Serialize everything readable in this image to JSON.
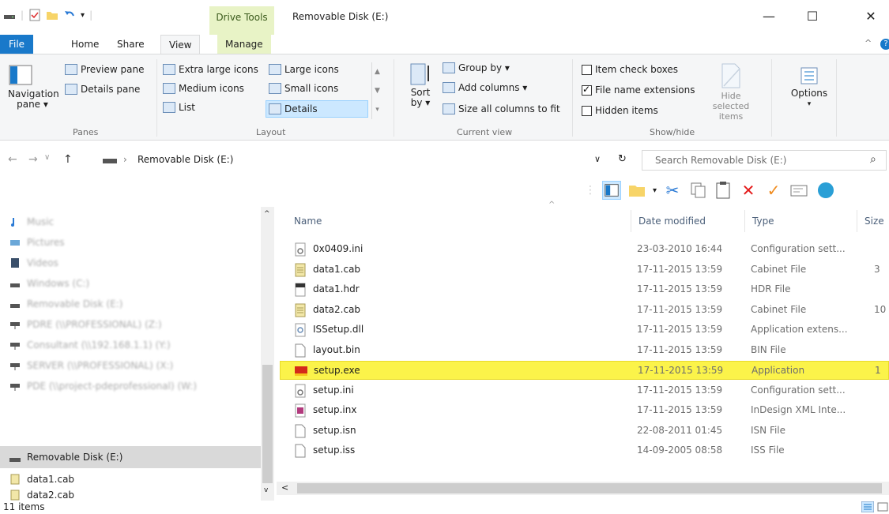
{
  "window": {
    "title": "Removable Disk (E:)",
    "context_tab": "Drive Tools",
    "minimize": "—",
    "maximize": "☐",
    "close": "✕"
  },
  "tabs": {
    "file": "File",
    "home": "Home",
    "share": "Share",
    "view": "View",
    "manage": "Manage"
  },
  "ribbon": {
    "panes": {
      "navigation_pane": "Navigation pane ▾",
      "preview_pane": "Preview pane",
      "details_pane": "Details pane",
      "label": "Panes"
    },
    "layout": {
      "extra_large_icons": "Extra large icons",
      "large_icons": "Large icons",
      "medium_icons": "Medium icons",
      "small_icons": "Small icons",
      "list": "List",
      "details": "Details",
      "label": "Layout"
    },
    "current_view": {
      "sort_by": "Sort by ▾",
      "group_by": "Group by ▾",
      "add_columns": "Add columns ▾",
      "size_all_columns": "Size all columns to fit",
      "label": "Current view"
    },
    "show_hide": {
      "item_check_boxes": "Item check boxes",
      "file_name_extensions": "File name extensions",
      "hidden_items": "Hidden items",
      "hide_selected_items": "Hide selected items",
      "label": "Show/hide",
      "file_name_extensions_checked": true
    },
    "options": "Options"
  },
  "address": {
    "path": "Removable Disk (E:)",
    "search_placeholder": "Search Removable Disk (E:)"
  },
  "nav_pane": {
    "items": [
      {
        "label": "Music",
        "blurred": true
      },
      {
        "label": "Pictures",
        "blurred": true
      },
      {
        "label": "Videos",
        "blurred": true
      },
      {
        "label": "Windows (C:)",
        "blurred": true
      },
      {
        "label": "Removable Disk (E:)",
        "blurred": true
      },
      {
        "label": "PDRE (\\\\PROFESSIONAL) (Z:)",
        "blurred": true
      },
      {
        "label": "Consultant (\\\\192.168.1.1) (Y:)",
        "blurred": true
      },
      {
        "label": "SERVER (\\\\PROFESSIONAL) (X:)",
        "blurred": true
      },
      {
        "label": "PDE (\\\\project-pdeprofessional) (W:)",
        "blurred": true
      },
      {
        "label": "Removable Disk (E:)",
        "blurred": false,
        "selected": true
      },
      {
        "label": "data1.cab",
        "blurred": false
      },
      {
        "label": "data2.cab",
        "blurred": false
      }
    ]
  },
  "columns": {
    "name": "Name",
    "date_modified": "Date modified",
    "type": "Type",
    "size": "Size"
  },
  "files": [
    {
      "name": "0x0409.ini",
      "date": "23-03-2010 16:44",
      "type": "Configuration sett...",
      "size": "",
      "icon": "settings-file-icon"
    },
    {
      "name": "data1.cab",
      "date": "17-11-2015 13:59",
      "type": "Cabinet File",
      "size": "3",
      "icon": "cabinet-file-icon"
    },
    {
      "name": "data1.hdr",
      "date": "17-11-2015 13:59",
      "type": "HDR File",
      "size": "",
      "icon": "hdr-file-icon"
    },
    {
      "name": "data2.cab",
      "date": "17-11-2015 13:59",
      "type": "Cabinet File",
      "size": "10",
      "icon": "cabinet-file-icon"
    },
    {
      "name": "ISSetup.dll",
      "date": "17-11-2015 13:59",
      "type": "Application extens...",
      "size": "",
      "icon": "dll-file-icon"
    },
    {
      "name": "layout.bin",
      "date": "17-11-2015 13:59",
      "type": "BIN File",
      "size": "",
      "icon": "blank-file-icon"
    },
    {
      "name": "setup.exe",
      "date": "17-11-2015 13:59",
      "type": "Application",
      "size": "1",
      "icon": "application-icon",
      "selected": true
    },
    {
      "name": "setup.ini",
      "date": "17-11-2015 13:59",
      "type": "Configuration sett...",
      "size": "",
      "icon": "settings-file-icon"
    },
    {
      "name": "setup.inx",
      "date": "17-11-2015 13:59",
      "type": "InDesign XML Inte...",
      "size": "",
      "icon": "indesign-file-icon"
    },
    {
      "name": "setup.isn",
      "date": "22-08-2011 01:45",
      "type": "ISN File",
      "size": "",
      "icon": "blank-file-icon"
    },
    {
      "name": "setup.iss",
      "date": "14-09-2005 08:58",
      "type": "ISS File",
      "size": "",
      "icon": "blank-file-icon"
    }
  ],
  "status": {
    "item_count": "11 items"
  },
  "colors": {
    "accent": "#1979ca",
    "context_tab": "#e8f3c6",
    "highlight": "#fbf34a"
  }
}
